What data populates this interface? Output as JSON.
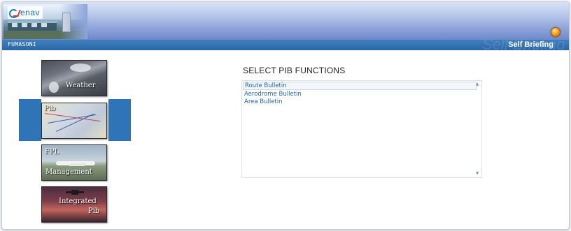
{
  "app": {
    "logo_text": "enav",
    "username": "FUMASONI",
    "title": "Self Briefing",
    "watermark": "Self Briefing"
  },
  "nav": {
    "weather": "Weather",
    "pib": "Pib",
    "fpl_line1": "FPL",
    "fpl_line2": "Management",
    "integrated_line1": "Integrated",
    "integrated_line2": "Pib",
    "selected": "Pib"
  },
  "main": {
    "heading": "SELECT PIB FUNCTIONS",
    "options": [
      "Route Bulletin",
      "Aerodrome Bulletin",
      "Area Bulletin"
    ],
    "selected_index": 0
  },
  "colors": {
    "selection_bg": "#2f74b6",
    "link": "#2463a8",
    "userbar": "#2b66a6",
    "status_orb": "#f6a21a"
  },
  "icons": {
    "status": "status-orb-icon",
    "scroll_up": "scroll-up-icon",
    "scroll_down": "scroll-down-icon"
  }
}
